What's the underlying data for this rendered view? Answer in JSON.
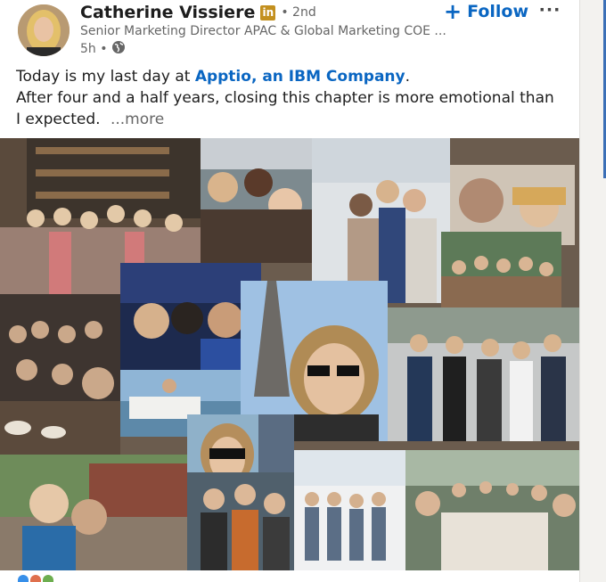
{
  "post": {
    "author": {
      "name": "Catherine Vissiere",
      "badge_icon": "linkedin-premium-icon",
      "badge_text": "in",
      "degree": "• 2nd",
      "headline": "Senior Marketing Director APAC & Global Marketing COE ...",
      "time": "5h •",
      "visibility_icon": "globe-icon"
    },
    "follow_label": "Follow",
    "follow_icon": "plus-icon",
    "overflow_icon": "ellipsis-icon",
    "overflow_label": "···",
    "text": {
      "line1_prefix": "Today is my last day at ",
      "company": "Apptio, an IBM Company",
      "line1_suffix": ".",
      "line2": "After four and a half years, closing this chapter is more emotional than I expected.",
      "see_more": "...more"
    },
    "collage_label": "photo collage",
    "colors": {
      "link": "#0a66c2",
      "name": "#1d1d1d",
      "muted": "#666666",
      "premium": "#c3901f"
    }
  }
}
